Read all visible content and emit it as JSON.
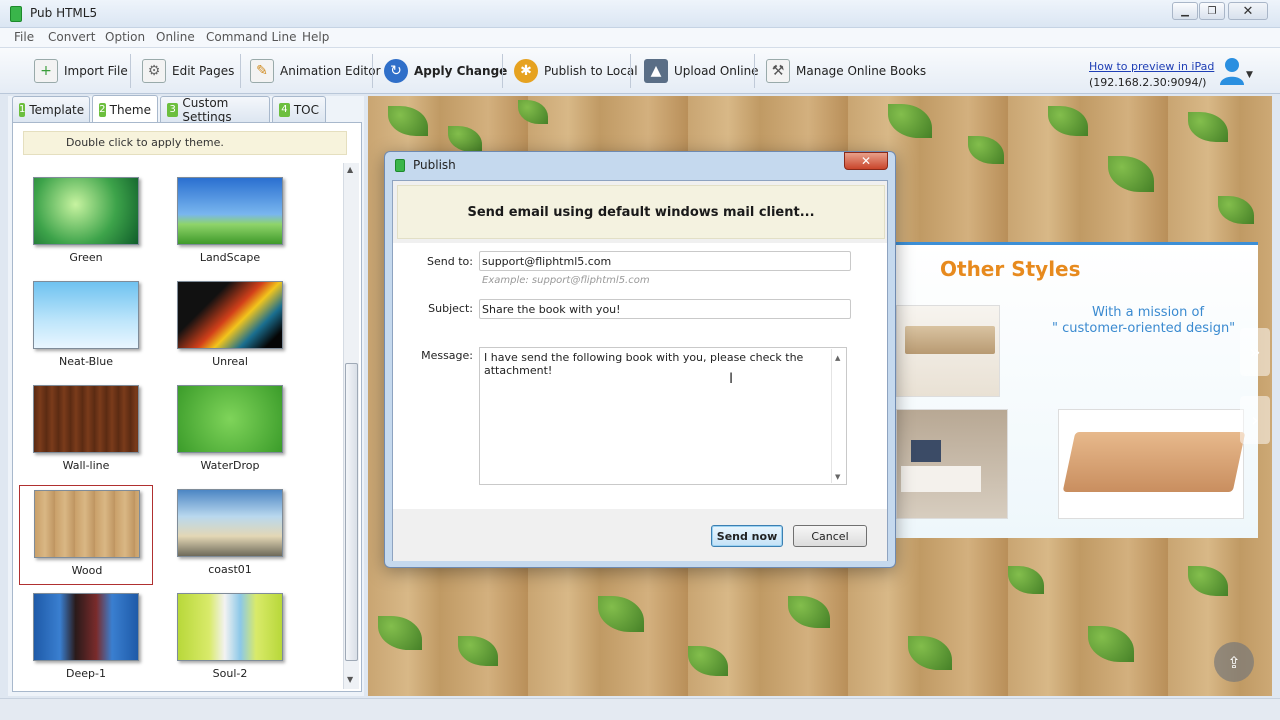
{
  "window": {
    "title": "Pub HTML5",
    "minimize": "▁",
    "maximize": "❐",
    "close": "✕"
  },
  "menu": [
    "File",
    "Convert",
    "Option",
    "Online",
    "Command Line",
    "Help"
  ],
  "toolbar": {
    "import_file": "Import File",
    "edit_pages": "Edit Pages",
    "animation_editor": "Animation Editor",
    "apply_change": "Apply Change",
    "publish_local": "Publish to Local",
    "upload_online": "Upload Online",
    "manage_online": "Manage Online Books",
    "help_link": "How to preview in iPad",
    "ip_address": "(192.168.2.30:9094/)"
  },
  "tabs": [
    {
      "num": "1",
      "label": "Template"
    },
    {
      "num": "2",
      "label": "Theme"
    },
    {
      "num": "3",
      "label": "Custom Settings"
    },
    {
      "num": "4",
      "label": "TOC"
    }
  ],
  "theme_panel": {
    "hint": "Double click to apply theme.",
    "themes": [
      "Green",
      "LandScape",
      "Neat-Blue",
      "Unreal",
      "Wall-line",
      "WaterDrop",
      "Wood",
      "coast01",
      "Deep-1",
      "Soul-2"
    ],
    "selected": "Wood"
  },
  "preview": {
    "page_title": "Other  Styles",
    "line1": "With a mission of",
    "line2": "\" customer-oriented design\""
  },
  "dialog": {
    "title": "Publish",
    "close_glyph": "✕",
    "header": "Send email using default windows mail client...",
    "send_to_label": "Send to:",
    "send_to_value": "support@fliphtml5.com",
    "send_to_example": "Example: support@fliphtml5.com",
    "subject_label": "Subject:",
    "subject_value": "Share the book with you!",
    "message_label": "Message:",
    "message_value": "I have send the following book with you, please check the attachment!",
    "send_button": "Send now",
    "cancel_button": "Cancel"
  },
  "colors": {
    "accent_green": "#39b54a",
    "link_blue": "#1f3fb5",
    "title_orange": "#e78a1e",
    "text_blue": "#3a8ad0"
  }
}
